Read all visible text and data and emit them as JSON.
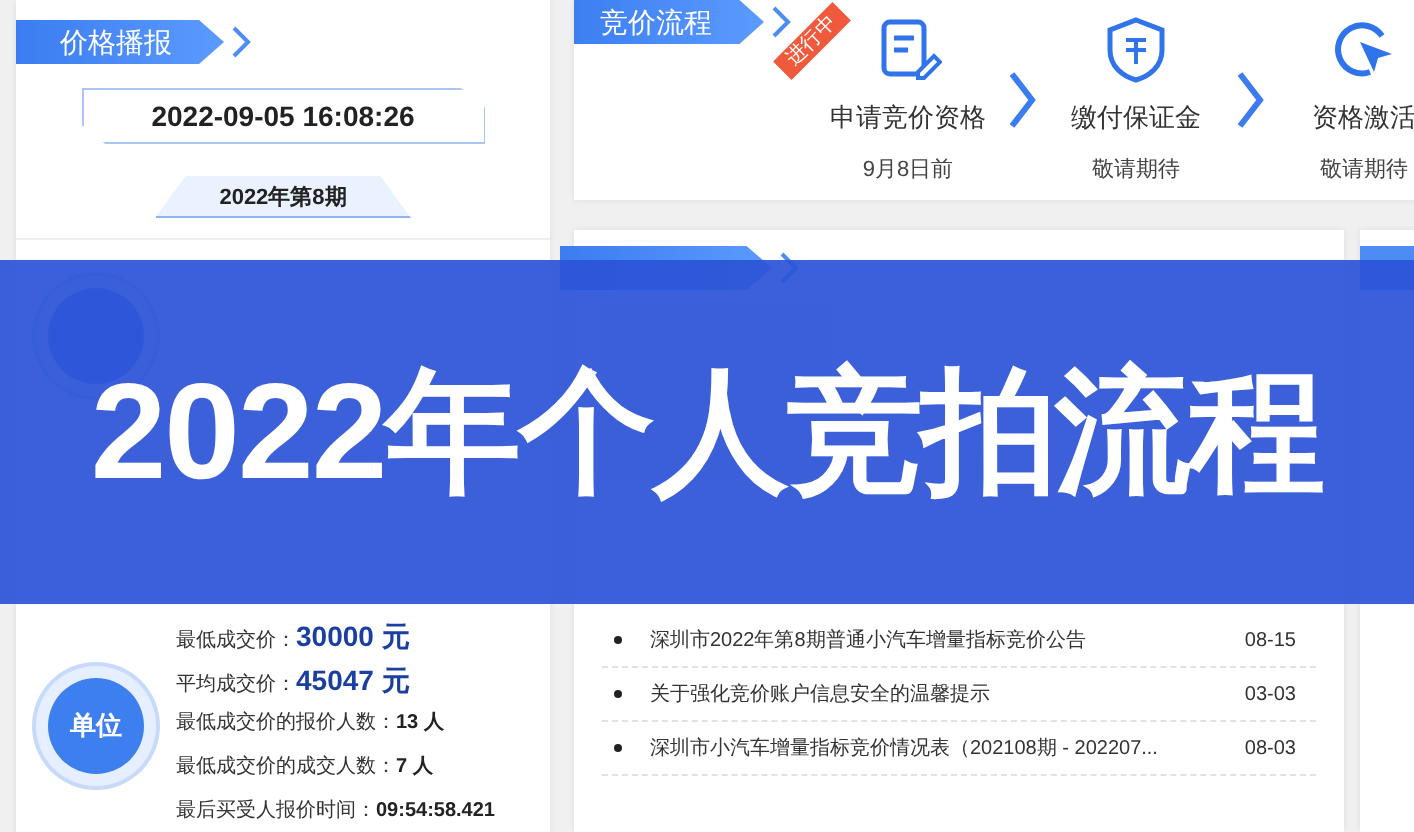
{
  "price_report": {
    "tag": "价格播报",
    "datetime": "2022-09-05 16:08:26",
    "period": "2022年第8期",
    "sections": [
      {
        "badge": "单位",
        "rows": [
          {
            "kind": "price",
            "label": "最低成交价：",
            "value": "30000 元"
          },
          {
            "kind": "price",
            "label": "平均成交价：",
            "value": "45047 元"
          },
          {
            "kind": "count",
            "label": "最低成交价的报价人数：",
            "value": "13 人"
          },
          {
            "kind": "count",
            "label": "最低成交价的成交人数：",
            "value": "7 人"
          },
          {
            "kind": "count",
            "label": "最后买受人报价时间：",
            "value": "09:54:58.421"
          }
        ]
      }
    ]
  },
  "process": {
    "tag": "竞价流程",
    "ribbon": "进行中",
    "steps": [
      {
        "kind": "form",
        "label": "申请竞价资格",
        "note": "9月8日前"
      },
      {
        "kind": "shield",
        "label": "缴付保证金",
        "note": "敬请期待"
      },
      {
        "kind": "cursor",
        "label": "资格激活",
        "note": "敬请期待"
      }
    ]
  },
  "notices": {
    "items": [
      {
        "title": "深圳市2022年第8期普通小汽车增量指标竞价公告",
        "date": "08-15"
      },
      {
        "title": "关于强化竞价账户信息安全的温馨提示",
        "date": "03-03"
      },
      {
        "title": "深圳市小汽车增量指标竞价情况表（202108期 - 202207...",
        "date": "08-03"
      }
    ]
  },
  "banner": {
    "title": "2022年个人竞拍流程"
  }
}
